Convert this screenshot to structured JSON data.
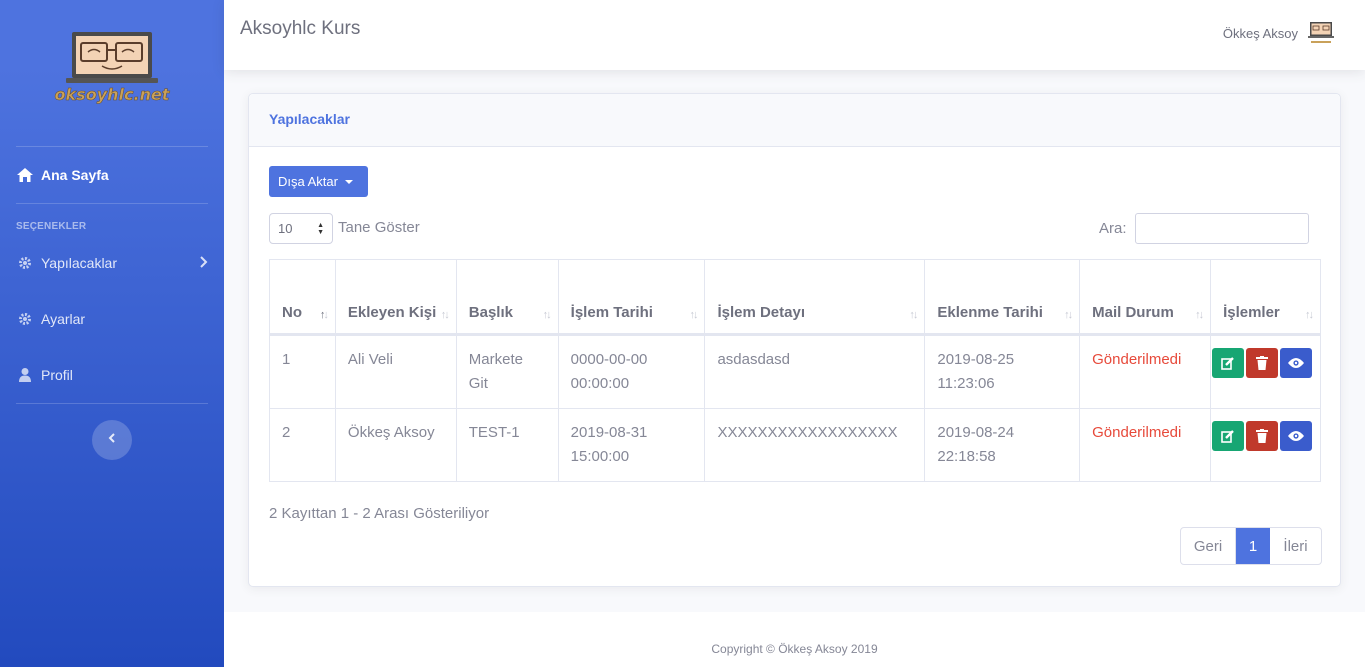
{
  "brand": {
    "logo_text": "oksoyhlc.net"
  },
  "sidebar": {
    "home": {
      "label": "Ana Sayfa",
      "icon": "home-icon"
    },
    "heading": "SEÇENEKLER",
    "items": [
      {
        "label": "Yapılacaklar",
        "icon": "gear-icon",
        "chevron": true
      },
      {
        "label": "Ayarlar",
        "icon": "gear-icon"
      },
      {
        "label": "Profil",
        "icon": "user-icon"
      }
    ],
    "toggle_icon": "chevron-left-icon"
  },
  "topbar": {
    "title": "Aksoyhlc Kurs",
    "user_name": "Ökkeş Aksoy"
  },
  "card": {
    "title": "Yapılacaklar",
    "export_label": "Dışa Aktar",
    "length_value": "10",
    "length_label": "Tane Göster",
    "search_label": "Ara:",
    "search_value": ""
  },
  "table": {
    "columns": [
      "No",
      "Ekleyen Kişi",
      "Başlık",
      "İşlem Tarihi",
      "İşlem Detayı",
      "Eklenme Tarihi",
      "Mail Durum",
      "İşlemler"
    ],
    "rows": [
      {
        "no": "1",
        "added_by": "Ali Veli",
        "title": "Markete Git",
        "date": "0000-00-00 00:00:00",
        "detail": "asdasdasd",
        "created": "2019-08-25 11:23:06",
        "mail": "Gönderilmedi"
      },
      {
        "no": "2",
        "added_by": "Ökkeş Aksoy",
        "title": "TEST-1",
        "date": "2019-08-31 15:00:00",
        "detail": "XXXXXXXXXXXXXXXXXX",
        "created": "2019-08-24 22:18:58",
        "mail": "Gönderilmedi"
      }
    ]
  },
  "info": "2 Kayıttan 1 - 2 Arası Gösteriliyor",
  "pagination": {
    "prev": "Geri",
    "current": "1",
    "next": "İleri"
  },
  "footer": "Copyright © Ökkeş Aksoy 2019",
  "colors": {
    "primary": "#4e73df",
    "success": "#1cc88a",
    "danger": "#e74a3b"
  }
}
